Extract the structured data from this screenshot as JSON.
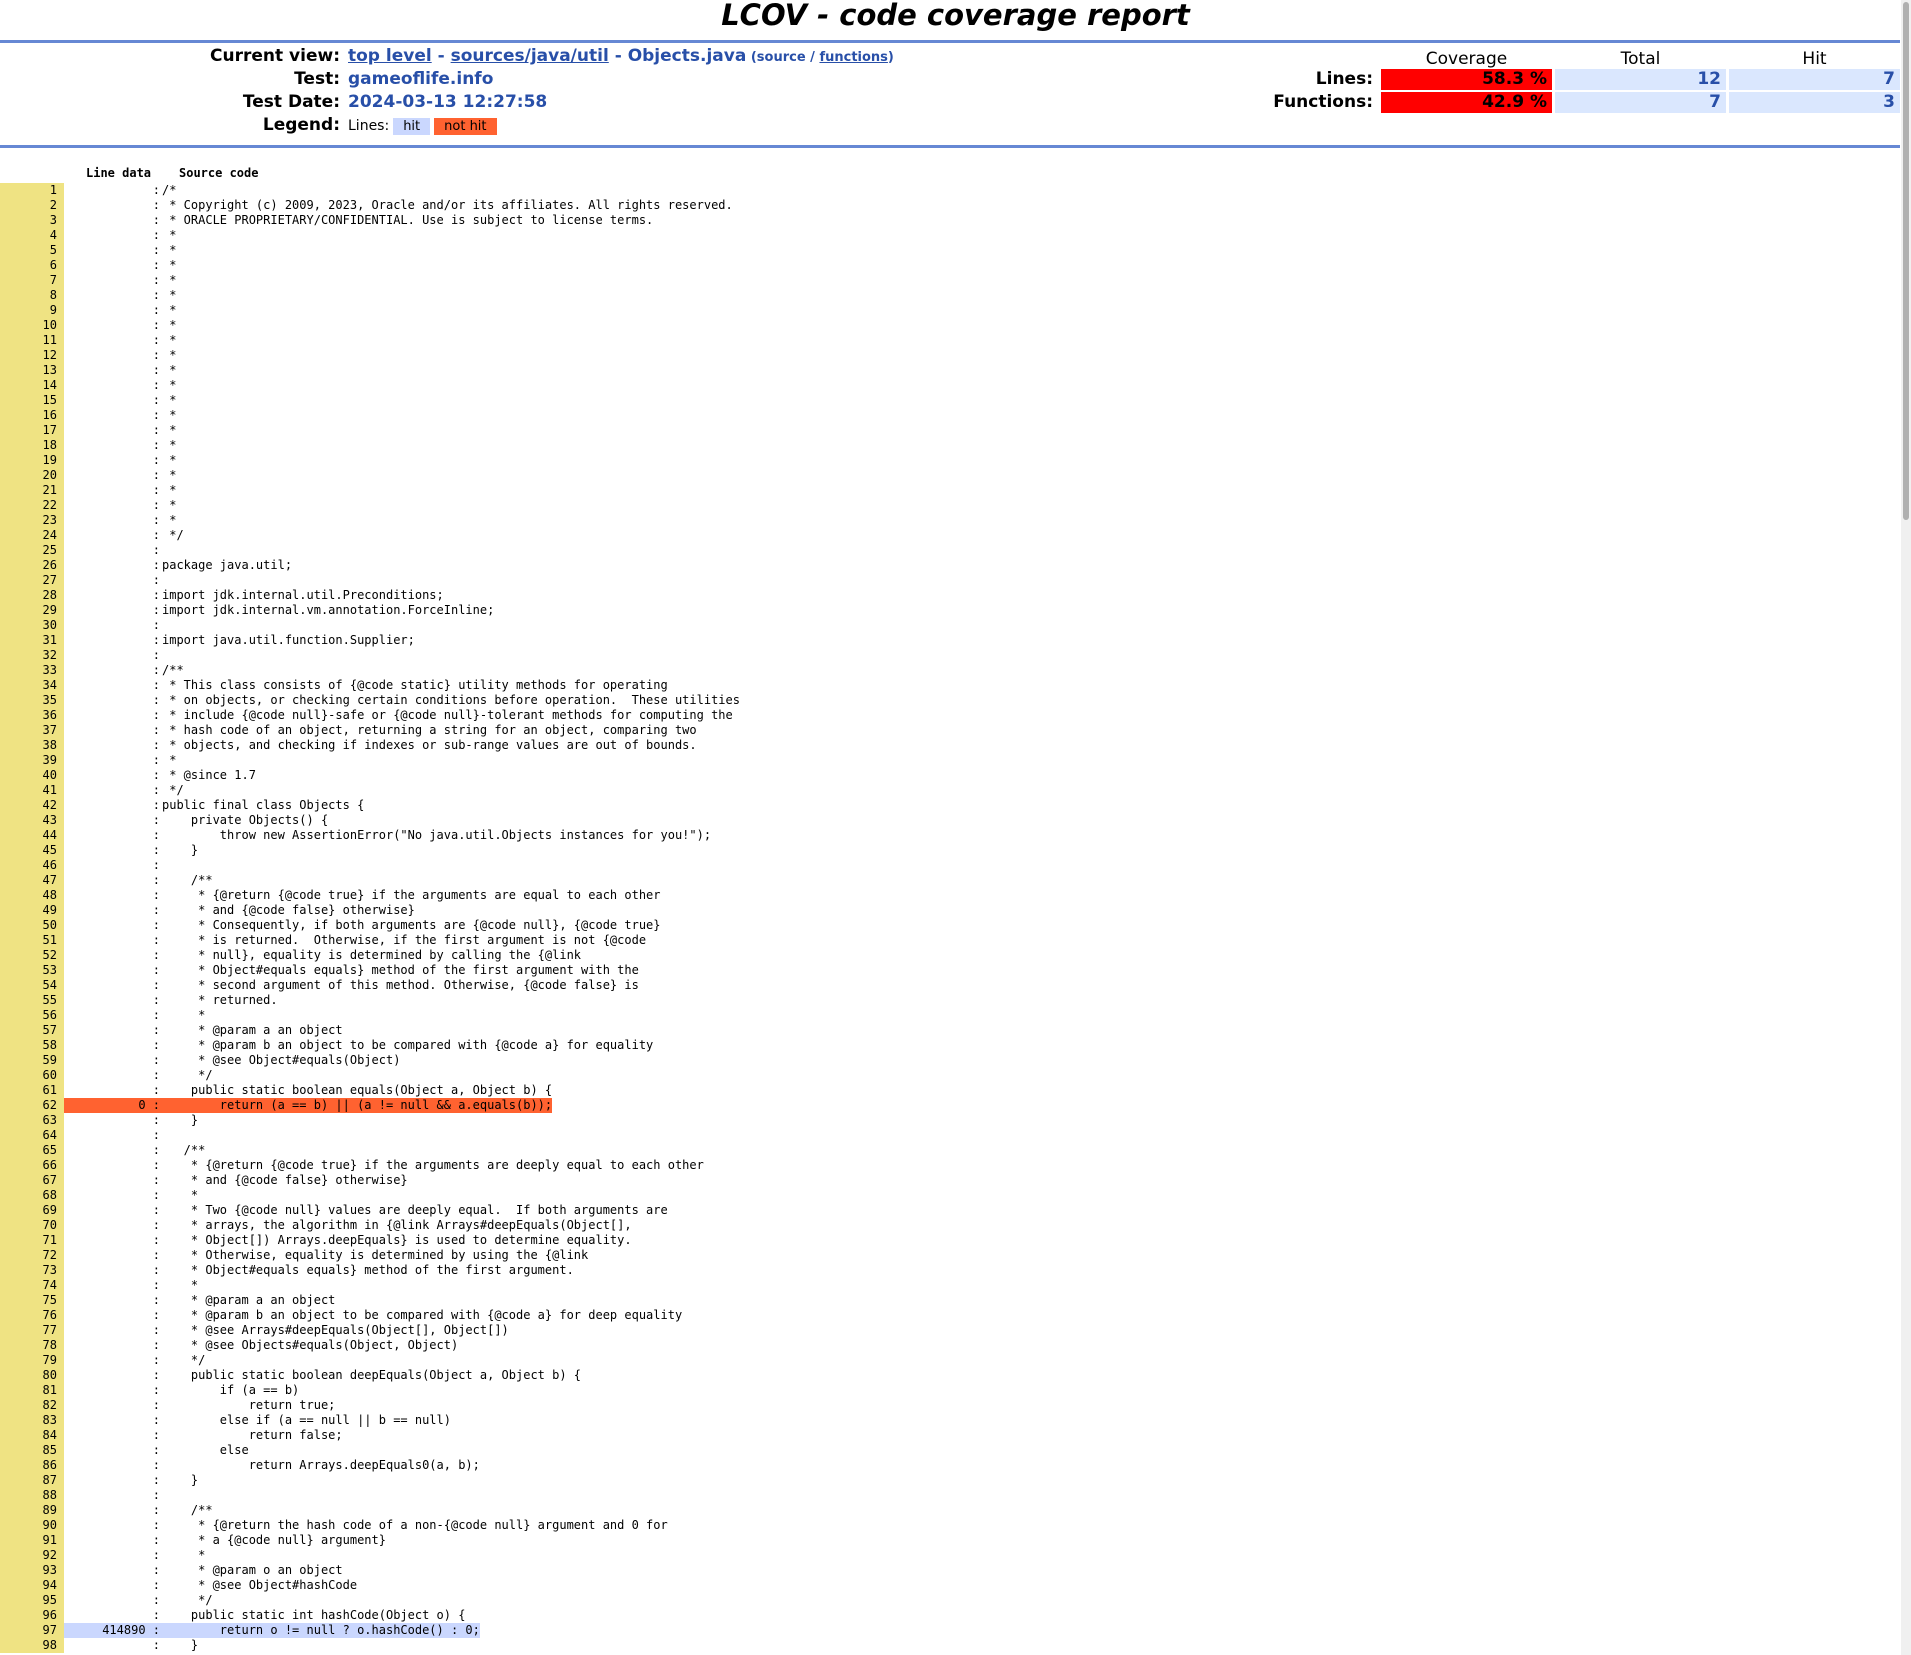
{
  "title": "LCOV - code coverage report",
  "header": {
    "current_view_label": "Current view:",
    "crumb_top": "top level",
    "crumb_sep1": " - ",
    "crumb_dir": "sources/java/util",
    "crumb_sep2": " - ",
    "crumb_file": "Objects.java",
    "crumb_open": " (",
    "crumb_source": "source",
    "crumb_slash": " / ",
    "crumb_functions": "functions",
    "crumb_close": ")",
    "test_label": "Test:",
    "test_value": "gameoflife.info",
    "date_label": "Test Date:",
    "date_value": "2024-03-13 12:27:58",
    "legend_label": "Legend:",
    "legend_lines": "Lines:",
    "legend_hit": "hit",
    "legend_nothit": "not hit"
  },
  "summary": {
    "col_coverage": "Coverage",
    "col_total": "Total",
    "col_hit": "Hit",
    "lines_label": "Lines:",
    "lines_coverage": "58.3 %",
    "lines_total": "12",
    "lines_hit": "7",
    "functions_label": "Functions:",
    "functions_coverage": "42.9 %",
    "functions_total": "7",
    "functions_hit": "3"
  },
  "table": {
    "col_line_data": "Line data",
    "col_source": "Source code"
  },
  "code_lines": [
    {
      "n": "1",
      "hits": "",
      "src": "/*"
    },
    {
      "n": "2",
      "hits": "",
      "src": " * Copyright (c) 2009, 2023, Oracle and/or its affiliates. All rights reserved."
    },
    {
      "n": "3",
      "hits": "",
      "src": " * ORACLE PROPRIETARY/CONFIDENTIAL. Use is subject to license terms."
    },
    {
      "n": "4",
      "hits": "",
      "src": " *"
    },
    {
      "n": "5",
      "hits": "",
      "src": " *"
    },
    {
      "n": "6",
      "hits": "",
      "src": " *"
    },
    {
      "n": "7",
      "hits": "",
      "src": " *"
    },
    {
      "n": "8",
      "hits": "",
      "src": " *"
    },
    {
      "n": "9",
      "hits": "",
      "src": " *"
    },
    {
      "n": "10",
      "hits": "",
      "src": " *"
    },
    {
      "n": "11",
      "hits": "",
      "src": " *"
    },
    {
      "n": "12",
      "hits": "",
      "src": " *"
    },
    {
      "n": "13",
      "hits": "",
      "src": " *"
    },
    {
      "n": "14",
      "hits": "",
      "src": " *"
    },
    {
      "n": "15",
      "hits": "",
      "src": " *"
    },
    {
      "n": "16",
      "hits": "",
      "src": " *"
    },
    {
      "n": "17",
      "hits": "",
      "src": " *"
    },
    {
      "n": "18",
      "hits": "",
      "src": " *"
    },
    {
      "n": "19",
      "hits": "",
      "src": " *"
    },
    {
      "n": "20",
      "hits": "",
      "src": " *"
    },
    {
      "n": "21",
      "hits": "",
      "src": " *"
    },
    {
      "n": "22",
      "hits": "",
      "src": " *"
    },
    {
      "n": "23",
      "hits": "",
      "src": " *"
    },
    {
      "n": "24",
      "hits": "",
      "src": " */"
    },
    {
      "n": "25",
      "hits": "",
      "src": ""
    },
    {
      "n": "26",
      "hits": "",
      "src": "package java.util;"
    },
    {
      "n": "27",
      "hits": "",
      "src": ""
    },
    {
      "n": "28",
      "hits": "",
      "src": "import jdk.internal.util.Preconditions;"
    },
    {
      "n": "29",
      "hits": "",
      "src": "import jdk.internal.vm.annotation.ForceInline;"
    },
    {
      "n": "30",
      "hits": "",
      "src": ""
    },
    {
      "n": "31",
      "hits": "",
      "src": "import java.util.function.Supplier;"
    },
    {
      "n": "32",
      "hits": "",
      "src": ""
    },
    {
      "n": "33",
      "hits": "",
      "src": "/**"
    },
    {
      "n": "34",
      "hits": "",
      "src": " * This class consists of {@code static} utility methods for operating"
    },
    {
      "n": "35",
      "hits": "",
      "src": " * on objects, or checking certain conditions before operation.  These utilities"
    },
    {
      "n": "36",
      "hits": "",
      "src": " * include {@code null}-safe or {@code null}-tolerant methods for computing the"
    },
    {
      "n": "37",
      "hits": "",
      "src": " * hash code of an object, returning a string for an object, comparing two"
    },
    {
      "n": "38",
      "hits": "",
      "src": " * objects, and checking if indexes or sub-range values are out of bounds."
    },
    {
      "n": "39",
      "hits": "",
      "src": " *"
    },
    {
      "n": "40",
      "hits": "",
      "src": " * @since 1.7"
    },
    {
      "n": "41",
      "hits": "",
      "src": " */"
    },
    {
      "n": "42",
      "hits": "",
      "src": "public final class Objects {"
    },
    {
      "n": "43",
      "hits": "",
      "src": "    private Objects() {"
    },
    {
      "n": "44",
      "hits": "",
      "src": "        throw new AssertionError(\"No java.util.Objects instances for you!\");"
    },
    {
      "n": "45",
      "hits": "",
      "src": "    }"
    },
    {
      "n": "46",
      "hits": "",
      "src": ""
    },
    {
      "n": "47",
      "hits": "",
      "src": "    /**"
    },
    {
      "n": "48",
      "hits": "",
      "src": "     * {@return {@code true} if the arguments are equal to each other"
    },
    {
      "n": "49",
      "hits": "",
      "src": "     * and {@code false} otherwise}"
    },
    {
      "n": "50",
      "hits": "",
      "src": "     * Consequently, if both arguments are {@code null}, {@code true}"
    },
    {
      "n": "51",
      "hits": "",
      "src": "     * is returned.  Otherwise, if the first argument is not {@code"
    },
    {
      "n": "52",
      "hits": "",
      "src": "     * null}, equality is determined by calling the {@link"
    },
    {
      "n": "53",
      "hits": "",
      "src": "     * Object#equals equals} method of the first argument with the"
    },
    {
      "n": "54",
      "hits": "",
      "src": "     * second argument of this method. Otherwise, {@code false} is"
    },
    {
      "n": "55",
      "hits": "",
      "src": "     * returned."
    },
    {
      "n": "56",
      "hits": "",
      "src": "     *"
    },
    {
      "n": "57",
      "hits": "",
      "src": "     * @param a an object"
    },
    {
      "n": "58",
      "hits": "",
      "src": "     * @param b an object to be compared with {@code a} for equality"
    },
    {
      "n": "59",
      "hits": "",
      "src": "     * @see Object#equals(Object)"
    },
    {
      "n": "60",
      "hits": "",
      "src": "     */"
    },
    {
      "n": "61",
      "hits": "",
      "src": "    public static boolean equals(Object a, Object b) {"
    },
    {
      "n": "62",
      "hits": "0",
      "src": "        return (a == b) || (a != null && a.equals(b));",
      "status": "nothit"
    },
    {
      "n": "63",
      "hits": "",
      "src": "    }"
    },
    {
      "n": "64",
      "hits": "",
      "src": ""
    },
    {
      "n": "65",
      "hits": "",
      "src": "   /**"
    },
    {
      "n": "66",
      "hits": "",
      "src": "    * {@return {@code true} if the arguments are deeply equal to each other"
    },
    {
      "n": "67",
      "hits": "",
      "src": "    * and {@code false} otherwise}"
    },
    {
      "n": "68",
      "hits": "",
      "src": "    *"
    },
    {
      "n": "69",
      "hits": "",
      "src": "    * Two {@code null} values are deeply equal.  If both arguments are"
    },
    {
      "n": "70",
      "hits": "",
      "src": "    * arrays, the algorithm in {@link Arrays#deepEquals(Object[],"
    },
    {
      "n": "71",
      "hits": "",
      "src": "    * Object[]) Arrays.deepEquals} is used to determine equality."
    },
    {
      "n": "72",
      "hits": "",
      "src": "    * Otherwise, equality is determined by using the {@link"
    },
    {
      "n": "73",
      "hits": "",
      "src": "    * Object#equals equals} method of the first argument."
    },
    {
      "n": "74",
      "hits": "",
      "src": "    *"
    },
    {
      "n": "75",
      "hits": "",
      "src": "    * @param a an object"
    },
    {
      "n": "76",
      "hits": "",
      "src": "    * @param b an object to be compared with {@code a} for deep equality"
    },
    {
      "n": "77",
      "hits": "",
      "src": "    * @see Arrays#deepEquals(Object[], Object[])"
    },
    {
      "n": "78",
      "hits": "",
      "src": "    * @see Objects#equals(Object, Object)"
    },
    {
      "n": "79",
      "hits": "",
      "src": "    */"
    },
    {
      "n": "80",
      "hits": "",
      "src": "    public static boolean deepEquals(Object a, Object b) {"
    },
    {
      "n": "81",
      "hits": "",
      "src": "        if (a == b)"
    },
    {
      "n": "82",
      "hits": "",
      "src": "            return true;"
    },
    {
      "n": "83",
      "hits": "",
      "src": "        else if (a == null || b == null)"
    },
    {
      "n": "84",
      "hits": "",
      "src": "            return false;"
    },
    {
      "n": "85",
      "hits": "",
      "src": "        else"
    },
    {
      "n": "86",
      "hits": "",
      "src": "            return Arrays.deepEquals0(a, b);"
    },
    {
      "n": "87",
      "hits": "",
      "src": "    }"
    },
    {
      "n": "88",
      "hits": "",
      "src": ""
    },
    {
      "n": "89",
      "hits": "",
      "src": "    /**"
    },
    {
      "n": "90",
      "hits": "",
      "src": "     * {@return the hash code of a non-{@code null} argument and 0 for"
    },
    {
      "n": "91",
      "hits": "",
      "src": "     * a {@code null} argument}"
    },
    {
      "n": "92",
      "hits": "",
      "src": "     *"
    },
    {
      "n": "93",
      "hits": "",
      "src": "     * @param o an object"
    },
    {
      "n": "94",
      "hits": "",
      "src": "     * @see Object#hashCode"
    },
    {
      "n": "95",
      "hits": "",
      "src": "     */"
    },
    {
      "n": "96",
      "hits": "",
      "src": "    public static int hashCode(Object o) {"
    },
    {
      "n": "97",
      "hits": "414890",
      "src": "        return o != null ? o.hashCode() : 0;",
      "status": "hit"
    },
    {
      "n": "98",
      "hits": "",
      "src": "    }"
    }
  ]
}
